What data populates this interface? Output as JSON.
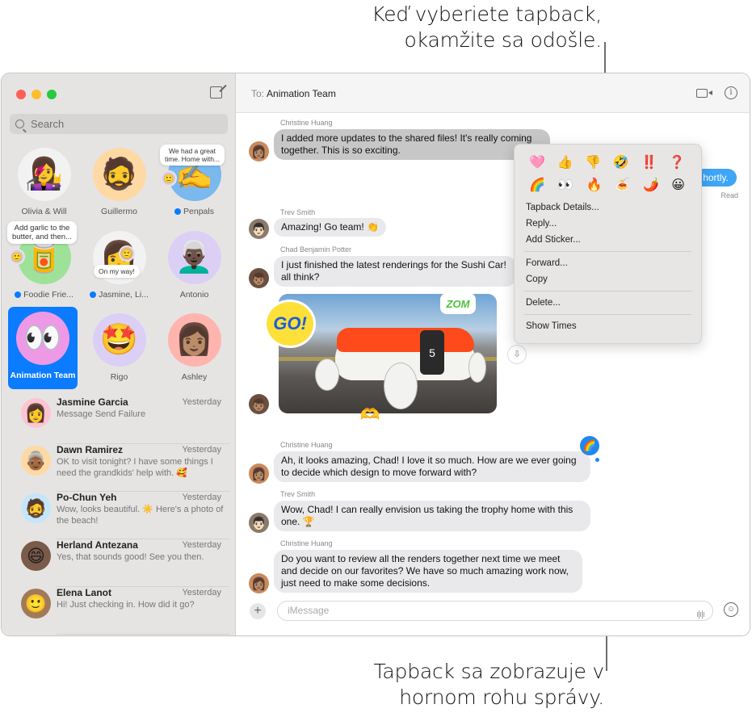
{
  "callouts": {
    "top": [
      "Keď vyberiete tapback,",
      "okamžite sa odošle."
    ],
    "bottom": [
      "Tapback sa zobrazuje v",
      "hornom rohu správy."
    ]
  },
  "sidebar": {
    "search_placeholder": "Search",
    "pinned": [
      {
        "label": "Olivia & Will",
        "emoji": "👩‍🎤",
        "color": "#f2f2f2",
        "unread": false
      },
      {
        "label": "Guillermo",
        "emoji": "🧔",
        "color": "#ffd9a3",
        "unread": false
      },
      {
        "label": "Penpals",
        "emoji": "✍️",
        "color": "#7ab8ee",
        "unread": true,
        "tip": [
          "We had a great",
          "time. Home with..."
        ]
      },
      {
        "label": "Foodie Frie...",
        "emoji": "🥫",
        "color": "#9ee29a",
        "unread": true,
        "tip": [
          "Add garlic to the",
          "butter, and then..."
        ]
      },
      {
        "label": "Jasmine, Li...",
        "emoji": "👩",
        "color": "#f2f2f2",
        "unread": true,
        "tip": [
          "On my way!"
        ]
      },
      {
        "label": "Antonio",
        "emoji": "👨🏿‍🦳",
        "color": "#dccff5",
        "unread": false
      },
      {
        "label": "Animation Team",
        "emoji": "👀",
        "color": "#ee99e6",
        "unread": false,
        "selected": true
      },
      {
        "label": "Rigo",
        "emoji": "🤩",
        "color": "#dccff5",
        "unread": false
      },
      {
        "label": "Ashley",
        "emoji": "👩🏽",
        "color": "#ffb4ae",
        "unread": false
      }
    ],
    "conversations": [
      {
        "name": "Jasmine Garcia",
        "time": "Yesterday",
        "preview": "Message Send Failure",
        "emoji": "👩",
        "color": "#ffc4d2"
      },
      {
        "name": "Dawn Ramirez",
        "time": "Yesterday",
        "preview": "OK to visit tonight? I have some things I need the grandkids' help with. 🥰",
        "emoji": "👵🏾",
        "color": "#ffd9a3"
      },
      {
        "name": "Po-Chun Yeh",
        "time": "Yesterday",
        "preview": "Wow, looks beautiful. ☀️ Here's a photo of the beach!",
        "emoji": "🧔",
        "color": "#c3e6fa"
      },
      {
        "name": "Herland Antezana",
        "time": "Yesterday",
        "preview": "Yes, that sounds good! See you then.",
        "emoji": "😄",
        "color": "#7a5a48"
      },
      {
        "name": "Elena Lanot",
        "time": "Yesterday",
        "preview": "Hi! Just checking in. How did it go?",
        "emoji": "🙂",
        "color": "#a07a5a"
      }
    ]
  },
  "header": {
    "to_label": "To:",
    "recipient": "Animation Team"
  },
  "messages": {
    "m1_sender": "Christine Huang",
    "m1_text": "I added more updates to the shared files! It's really coming together. This is so exciting.",
    "outgoing_text": "hortly.",
    "outgoing_status": "Read",
    "m2_sender": "Trev Smith",
    "m2_text": "Amazing! Go team! 👏",
    "m3_sender": "Chad Benjamin Potter",
    "m3_text": "I just finished the latest renderings for the Sushi Car! all think?",
    "car_number": "5",
    "sticker_go": "GO!",
    "sticker_zoom": "ZOM",
    "m4_sender": "Christine Huang",
    "m4_text": "Ah, it looks amazing, Chad! I love it so much. How are we ever going to decide which design to move forward with?",
    "m4_tapback": "🌈",
    "m5_sender": "Trev Smith",
    "m5_text": "Wow, Chad! I can really envision us taking the trophy home with this one. 🏆",
    "m6_sender": "Christine Huang",
    "m6_text": "Do you want to review all the renders together next time we meet and decide on our favorites? We have so much amazing work now, just need to make some decisions."
  },
  "composer": {
    "placeholder": "iMessage"
  },
  "menu": {
    "tapbacks_row1": [
      "🩷",
      "👍",
      "👎",
      "🤣",
      "‼️",
      "❓"
    ],
    "tapbacks_row2": [
      "🌈",
      "👀",
      "🔥",
      "🍝",
      "🌶️",
      "😀"
    ],
    "group1": [
      "Tapback Details...",
      "Reply...",
      "Add Sticker..."
    ],
    "group2": [
      "Forward...",
      "Copy"
    ],
    "group3": [
      "Delete..."
    ],
    "group4": [
      "Show Times"
    ]
  }
}
